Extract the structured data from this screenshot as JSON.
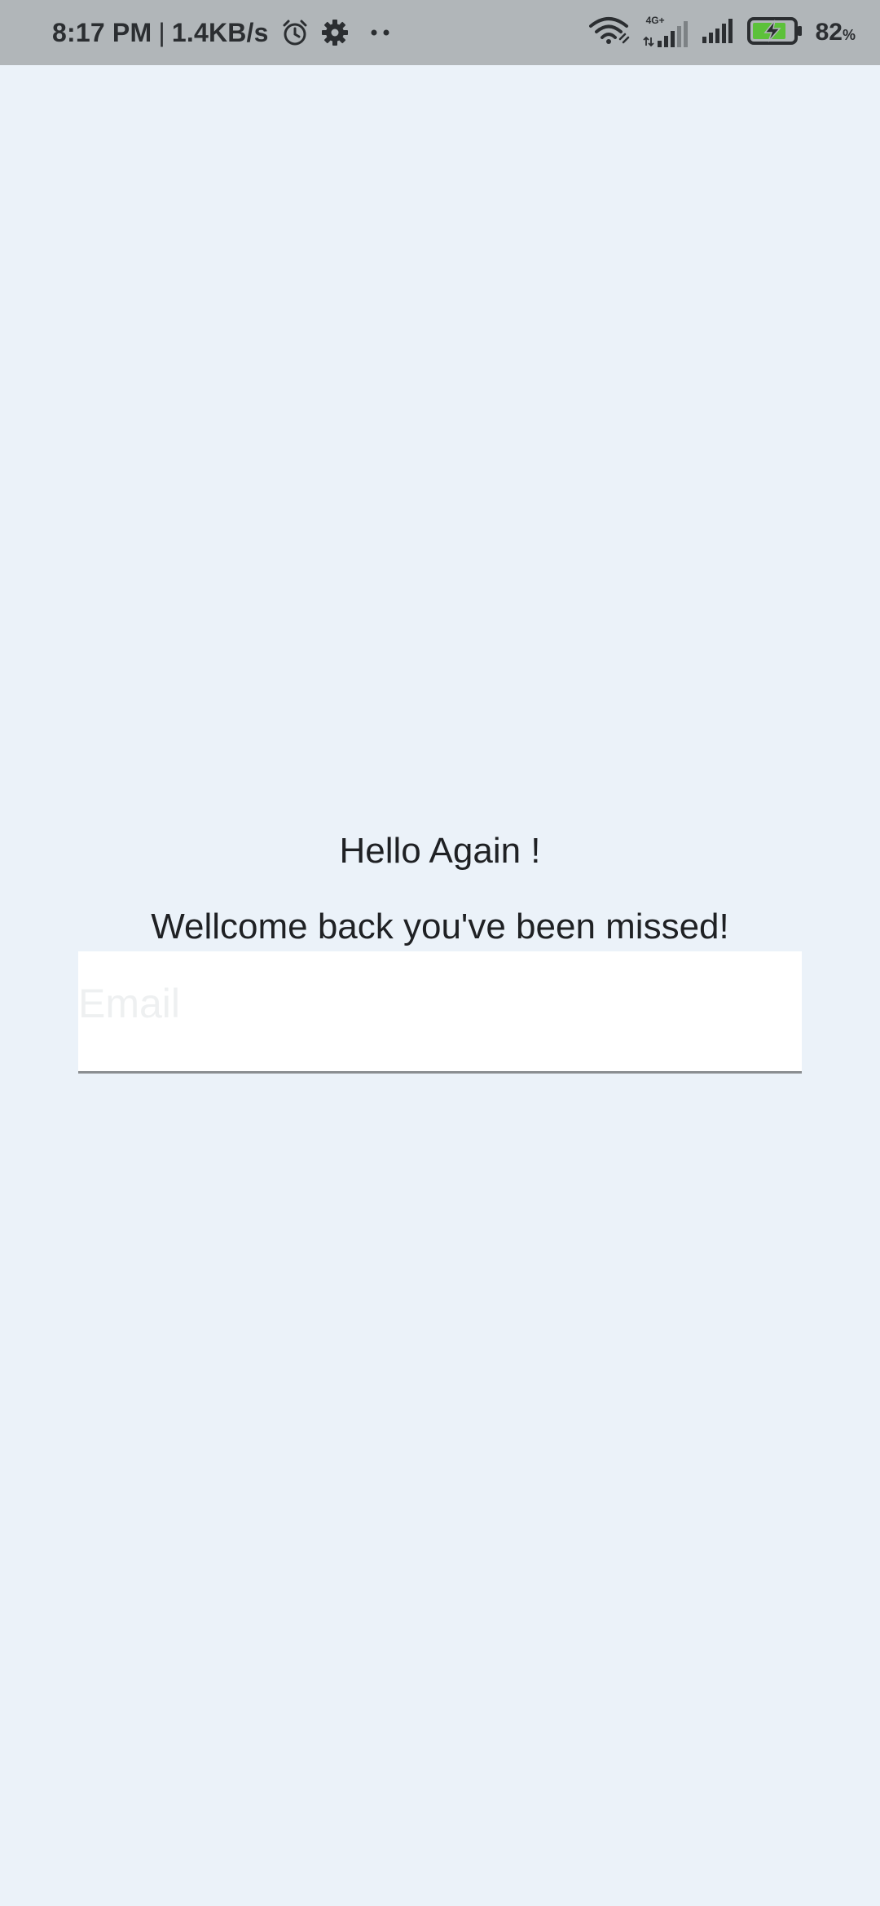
{
  "status_bar": {
    "time": "8:17 PM",
    "separator": "|",
    "net_speed": "1.4KB/s",
    "network_type": "4G+",
    "battery_percent": "82",
    "battery_unit": "%",
    "icons": [
      "alarm-icon",
      "settings-icon",
      "more-dots-icon",
      "wifi-icon",
      "signal-icon",
      "battery-charging-icon"
    ],
    "battery_color": "#5cc13a"
  },
  "login": {
    "title": "Hello Again !",
    "subtitle": "Wellcome back you've been missed!",
    "email_value": "",
    "email_placeholder": "Email"
  },
  "colors": {
    "background": "#ebf2f9",
    "status_bar": "#b1b6b9",
    "field_background": "#ffffff",
    "field_underline": "#8b8e91"
  }
}
